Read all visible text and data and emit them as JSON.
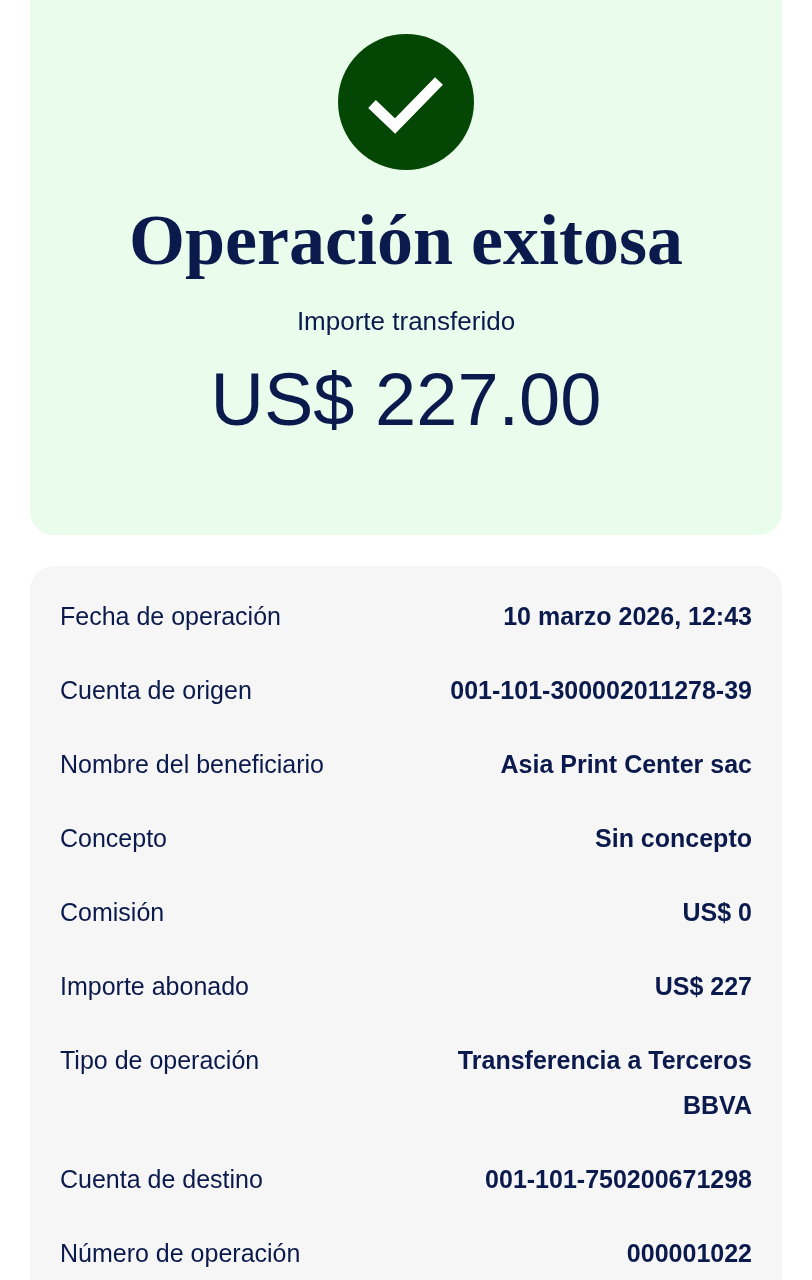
{
  "result": {
    "title": "Operación exitosa",
    "subtitle": "Importe transferido",
    "amount": "US$ 227.00"
  },
  "details": [
    {
      "label": "Fecha de operación",
      "value": "10 marzo 2026, 12:43"
    },
    {
      "label": "Cuenta de origen",
      "value": "001-101-300002011278-39"
    },
    {
      "label": "Nombre del beneficiario",
      "value": "Asia Print Center sac"
    },
    {
      "label": "Concepto",
      "value": "Sin concepto"
    },
    {
      "label": "Comisión",
      "value": "US$ 0"
    },
    {
      "label": "Importe abonado",
      "value": "US$ 227"
    },
    {
      "label": "Tipo de operación",
      "value": "Transferencia a Terceros BBVA"
    },
    {
      "label": "Cuenta de destino",
      "value": "001-101-750200671298"
    },
    {
      "label": "Número de operación",
      "value": "000001022"
    }
  ]
}
